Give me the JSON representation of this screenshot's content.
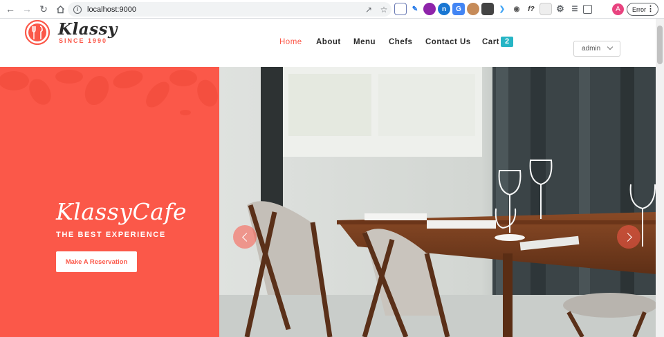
{
  "browser": {
    "url": "localhost:9000",
    "profile_initial": "A",
    "error_label": "Error"
  },
  "site": {
    "logo_name": "Klassy",
    "logo_tagline": "SINCE 1990",
    "brand_color": "#fb5849",
    "accent_color": "#26b5c5"
  },
  "nav": {
    "items": [
      {
        "label": "Home",
        "active": true
      },
      {
        "label": "About"
      },
      {
        "label": "Menu"
      },
      {
        "label": "Chefs"
      },
      {
        "label": "Contact Us"
      },
      {
        "label": "Cart"
      }
    ],
    "cart_count": "2",
    "user_menu": "admin"
  },
  "hero": {
    "title": "KlassyCafe",
    "subtitle": "THE BEST EXPERIENCE",
    "cta": "Make A Reservation"
  }
}
